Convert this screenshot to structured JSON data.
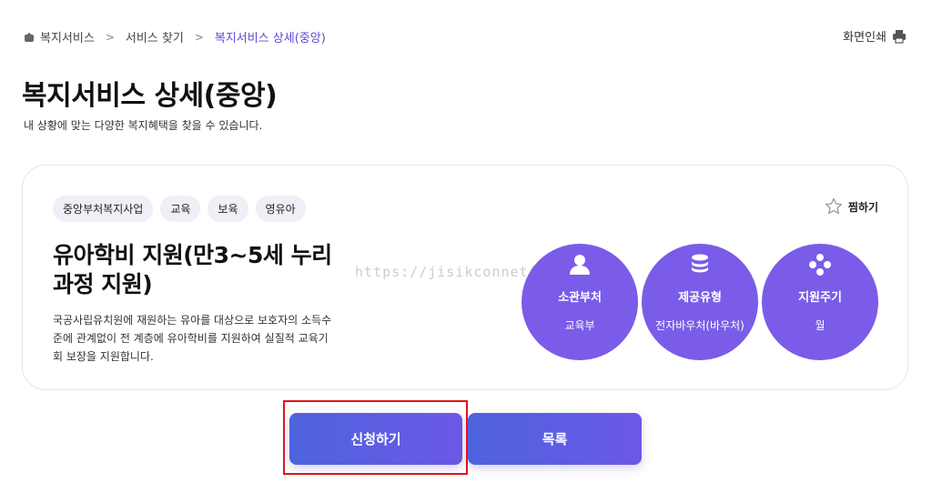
{
  "breadcrumb": {
    "items": [
      "복지서비스",
      "서비스 찾기",
      "복지서비스 상세(중앙)"
    ],
    "separator": ">"
  },
  "print": {
    "label": "화면인쇄"
  },
  "page": {
    "title": "복지서비스 상세(중앙)",
    "subtitle": "내 상황에 맞는 다양한 복지혜택을 찾을 수 있습니다."
  },
  "service": {
    "tags": [
      "중앙부처복지사업",
      "교육",
      "보육",
      "영유아"
    ],
    "favorite_label": "찜하기",
    "title": "유아학비 지원(만3~5세 누리과정 지원)",
    "description": "국공사립유치원에 재원하는 유아를 대상으로 보호자의 소득수준에 관계없이 전 계층에 유아학비를 지원하여 실질적 교육기회 보장을 지원합니다.",
    "info": [
      {
        "label": "소관부처",
        "value": "교육부",
        "icon": "person-icon"
      },
      {
        "label": "제공유형",
        "value": "전자바우처(바우처)",
        "icon": "coins-icon"
      },
      {
        "label": "지원주기",
        "value": "월",
        "icon": "diamond-dots-icon"
      }
    ]
  },
  "watermark": "https://jisikconnetion.com/",
  "actions": {
    "apply_label": "신청하기",
    "list_label": "목록"
  },
  "colors": {
    "accent": "#7a5ce8",
    "button": "#5a5fe2",
    "highlight": "#e0141c",
    "current_crumb": "#5b48d6"
  }
}
